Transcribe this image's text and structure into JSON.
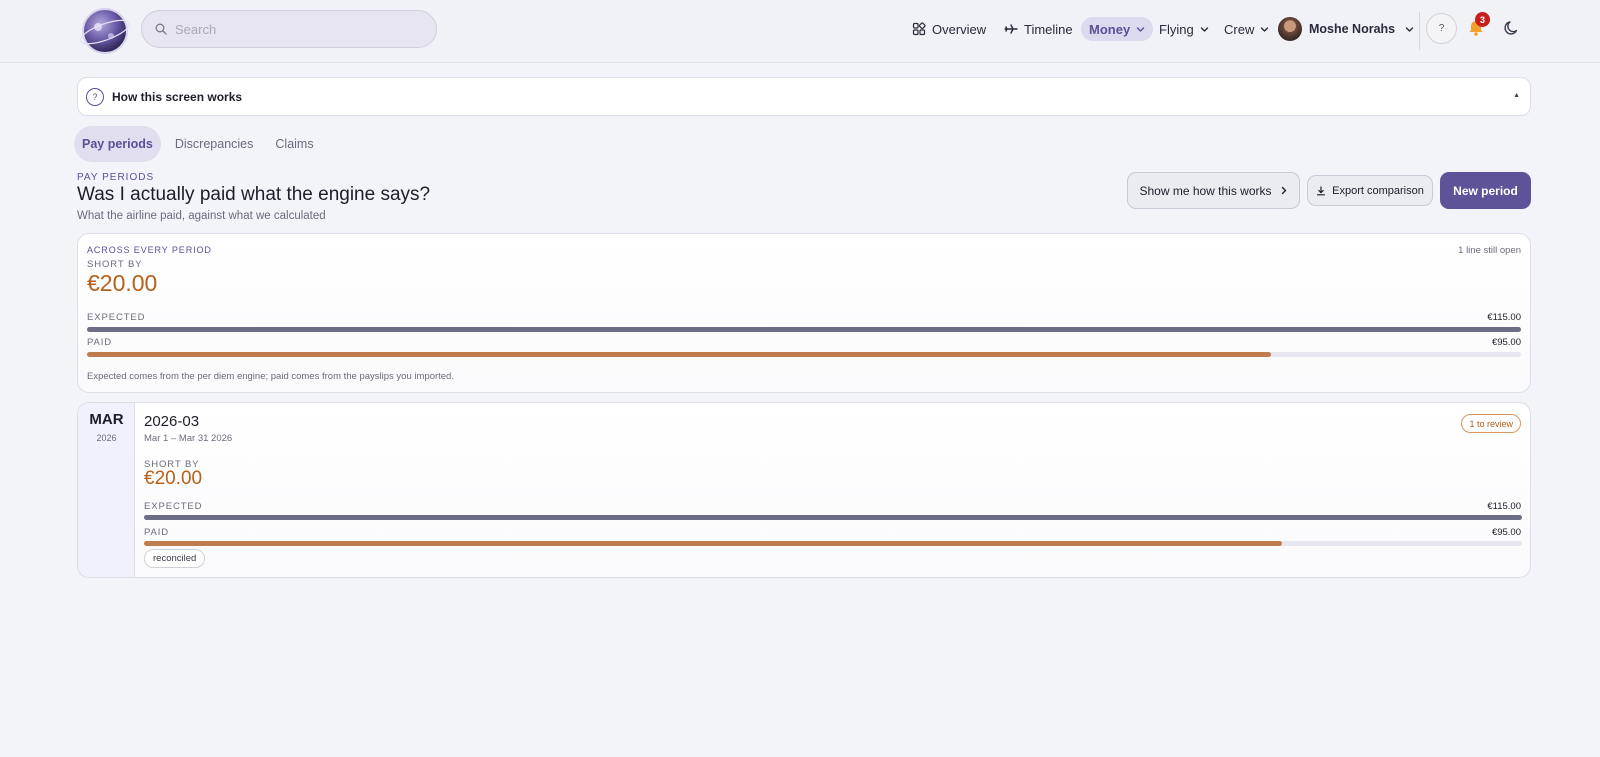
{
  "header": {
    "search_placeholder": "Search",
    "nav": {
      "overview": "Overview",
      "timeline": "Timeline",
      "money": "Money",
      "flying": "Flying",
      "crew": "Crew"
    },
    "user": {
      "name": "Moshe Norahs"
    },
    "help_label": "?",
    "notification_count": "3",
    "icons": [
      "search-icon",
      "dashboard-icon",
      "plane-icon",
      "chevron-down-icon",
      "bell-icon",
      "moon-icon"
    ]
  },
  "howto": {
    "label": "How this screen works",
    "caret": "▲"
  },
  "tabs": [
    "Pay periods",
    "Discrepancies",
    "Claims"
  ],
  "page": {
    "eyebrow": "PAY PERIODS",
    "title": "Was I actually paid what the engine says?",
    "subtitle": "What the airline paid, against what we calculated",
    "actions": {
      "show": "Show me how this works",
      "export": "Export comparison",
      "new": "New period"
    }
  },
  "summary": {
    "eyebrow": "ACROSS EVERY PERIOD",
    "open_status": "1 line still open",
    "short_label": "SHORT BY",
    "short_amount": "€20.00",
    "expected_label": "EXPECTED",
    "expected_value": "€115.00",
    "paid_label": "PAID",
    "paid_value": "€95.00",
    "paid_fraction": 0.826,
    "footnote": "Expected comes from the per diem engine; paid comes from the payslips you imported."
  },
  "periods": [
    {
      "month": "MAR",
      "year": "2026",
      "name": "2026-03",
      "range": "Mar 1 – Mar 31 2026",
      "review": "1 to review",
      "short_label": "SHORT BY",
      "short_amount": "€20.00",
      "expected_label": "EXPECTED",
      "expected_value": "€115.00",
      "paid_label": "PAID",
      "paid_value": "€95.00",
      "paid_fraction": 0.826,
      "status_chip": "reconciled"
    }
  ],
  "colors": {
    "accent": "#5e5399",
    "short": "#b7601a",
    "expected_bar": "#6d6e86",
    "paid_bar": "#c07c4f",
    "badge": "#c81e1e"
  }
}
